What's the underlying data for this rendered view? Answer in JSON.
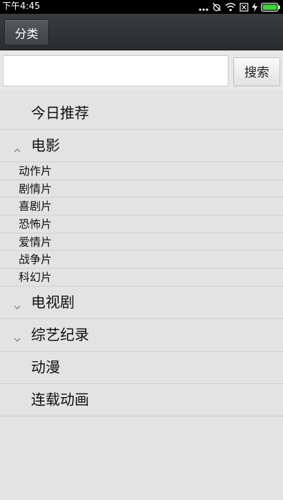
{
  "status_bar": {
    "time": "下午4:45"
  },
  "action_bar": {
    "category_label": "分类"
  },
  "search": {
    "value": "",
    "placeholder": "",
    "button_label": "搜索"
  },
  "categories": [
    {
      "label": "今日推荐",
      "expandable": false
    },
    {
      "label": "电影",
      "expandable": true,
      "expanded": true,
      "children": [
        "动作片",
        "剧情片",
        "喜剧片",
        "恐怖片",
        "爱情片",
        "战争片",
        "科幻片"
      ]
    },
    {
      "label": "电视剧",
      "expandable": true,
      "expanded": false
    },
    {
      "label": "综艺纪录",
      "expandable": true,
      "expanded": false
    },
    {
      "label": "动漫",
      "expandable": false
    },
    {
      "label": "连载动画",
      "expandable": false
    }
  ],
  "icons": {
    "chevron_up": "chevron-up-icon",
    "chevron_down": "chevron-down-icon"
  },
  "colors": {
    "status_bar": "#000000",
    "action_bar": "#2f3234",
    "list_background": "#e3e3e3",
    "battery_charge": "#3fd13f"
  }
}
